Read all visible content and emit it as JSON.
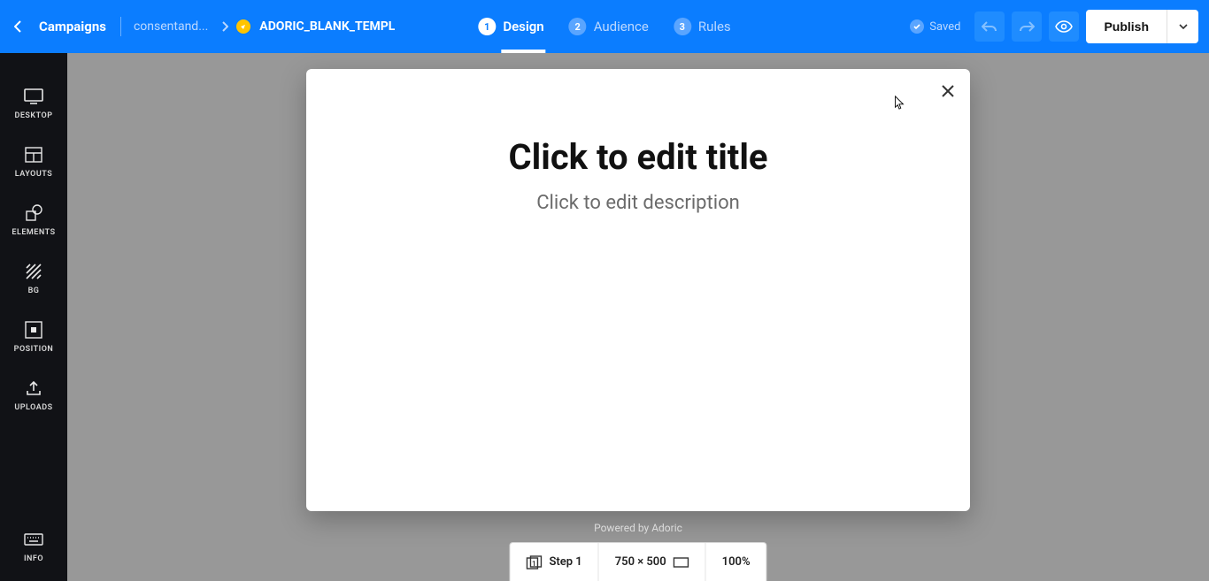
{
  "header": {
    "campaigns_label": "Campaigns",
    "site_name": "consentand...",
    "template_name": "ADORIC_BLANK_TEMPL",
    "saved_label": "Saved",
    "publish_label": "Publish"
  },
  "steps": [
    {
      "num": "1",
      "label": "Design",
      "active": true
    },
    {
      "num": "2",
      "label": "Audience",
      "active": false
    },
    {
      "num": "3",
      "label": "Rules",
      "active": false
    }
  ],
  "sidebar": {
    "items": [
      {
        "id": "desktop",
        "label": "DESKTOP"
      },
      {
        "id": "layouts",
        "label": "LAYOUTS"
      },
      {
        "id": "elements",
        "label": "ELEMENTS"
      },
      {
        "id": "bg",
        "label": "BG"
      },
      {
        "id": "position",
        "label": "POSITION"
      },
      {
        "id": "uploads",
        "label": "UPLOADS"
      }
    ],
    "info_label": "INFO"
  },
  "modal": {
    "title": "Click to edit title",
    "description": "Click to edit description"
  },
  "powered_by": "Powered by Adoric",
  "bottombar": {
    "step_label": "Step 1",
    "dimensions": "750 × 500",
    "zoom": "100%"
  }
}
